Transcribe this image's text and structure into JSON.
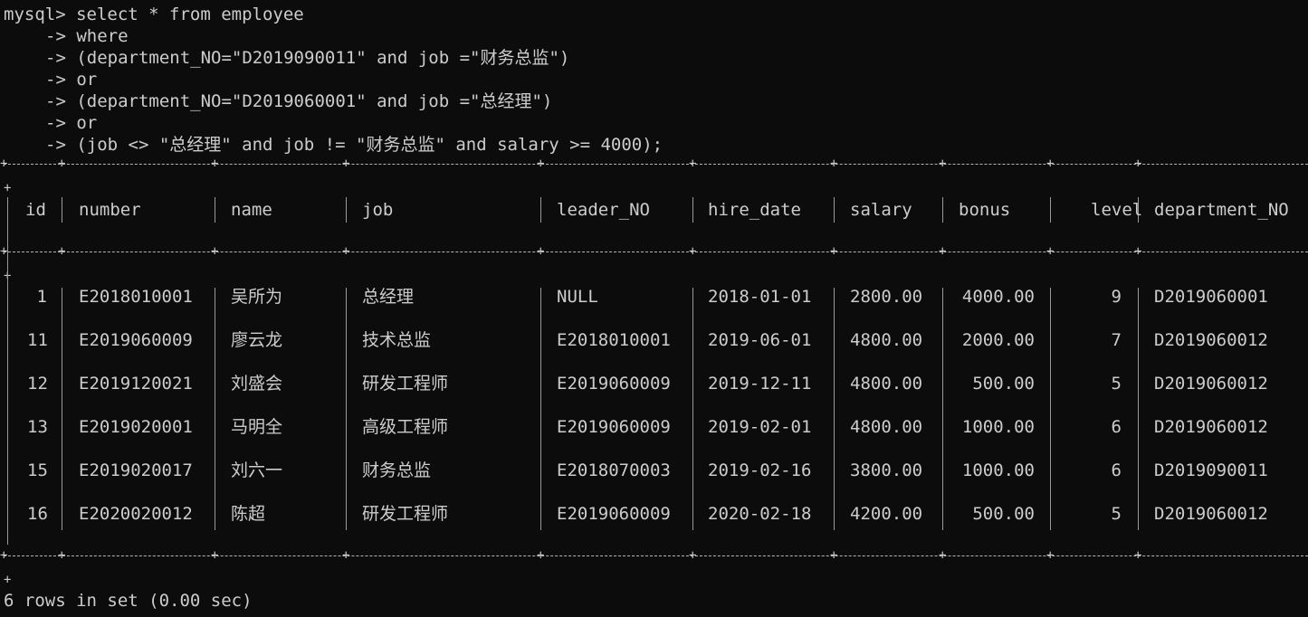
{
  "query": {
    "prompt": "mysql>",
    "first": "select * from employee",
    "continuation_prompt": "->",
    "lines": [
      "where",
      "(department_NO=\"D2019090011\" and job =\"财务总监\")",
      "or",
      "(department_NO=\"D2019060001\" and job =\"总经理\")",
      "or",
      "(job <> \"总经理\" and job != \"财务总监\" and salary >= 4000);"
    ]
  },
  "table": {
    "columns": [
      "id",
      "number",
      "name",
      "job",
      "leader_NO",
      "hire_date",
      "salary",
      "bonus",
      "level",
      "department_NO"
    ],
    "rows": [
      [
        "1",
        "E2018010001",
        "吴所为",
        "总经理",
        "NULL",
        "2018-01-01",
        "2800.00",
        "4000.00",
        "9",
        "D2019060001"
      ],
      [
        "11",
        "E2019060009",
        "廖云龙",
        "技术总监",
        "E2018010001",
        "2019-06-01",
        "4800.00",
        "2000.00",
        "7",
        "D2019060012"
      ],
      [
        "12",
        "E2019120021",
        "刘盛会",
        "研发工程师",
        "E2019060009",
        "2019-12-11",
        "4800.00",
        "500.00",
        "5",
        "D2019060012"
      ],
      [
        "13",
        "E2019020001",
        "马明全",
        "高级工程师",
        "E2019060009",
        "2019-02-01",
        "4800.00",
        "1000.00",
        "6",
        "D2019060012"
      ],
      [
        "15",
        "E2019020017",
        "刘六一",
        "财务总监",
        "E2018070003",
        "2019-02-16",
        "3800.00",
        "1000.00",
        "6",
        "D2019090011"
      ],
      [
        "16",
        "E2020020012",
        "陈超",
        "研发工程师",
        "E2019060009",
        "2020-02-18",
        "4200.00",
        "500.00",
        "5",
        "D2019060012"
      ]
    ]
  },
  "result_summary": "6 rows in set (0.00 sec)"
}
